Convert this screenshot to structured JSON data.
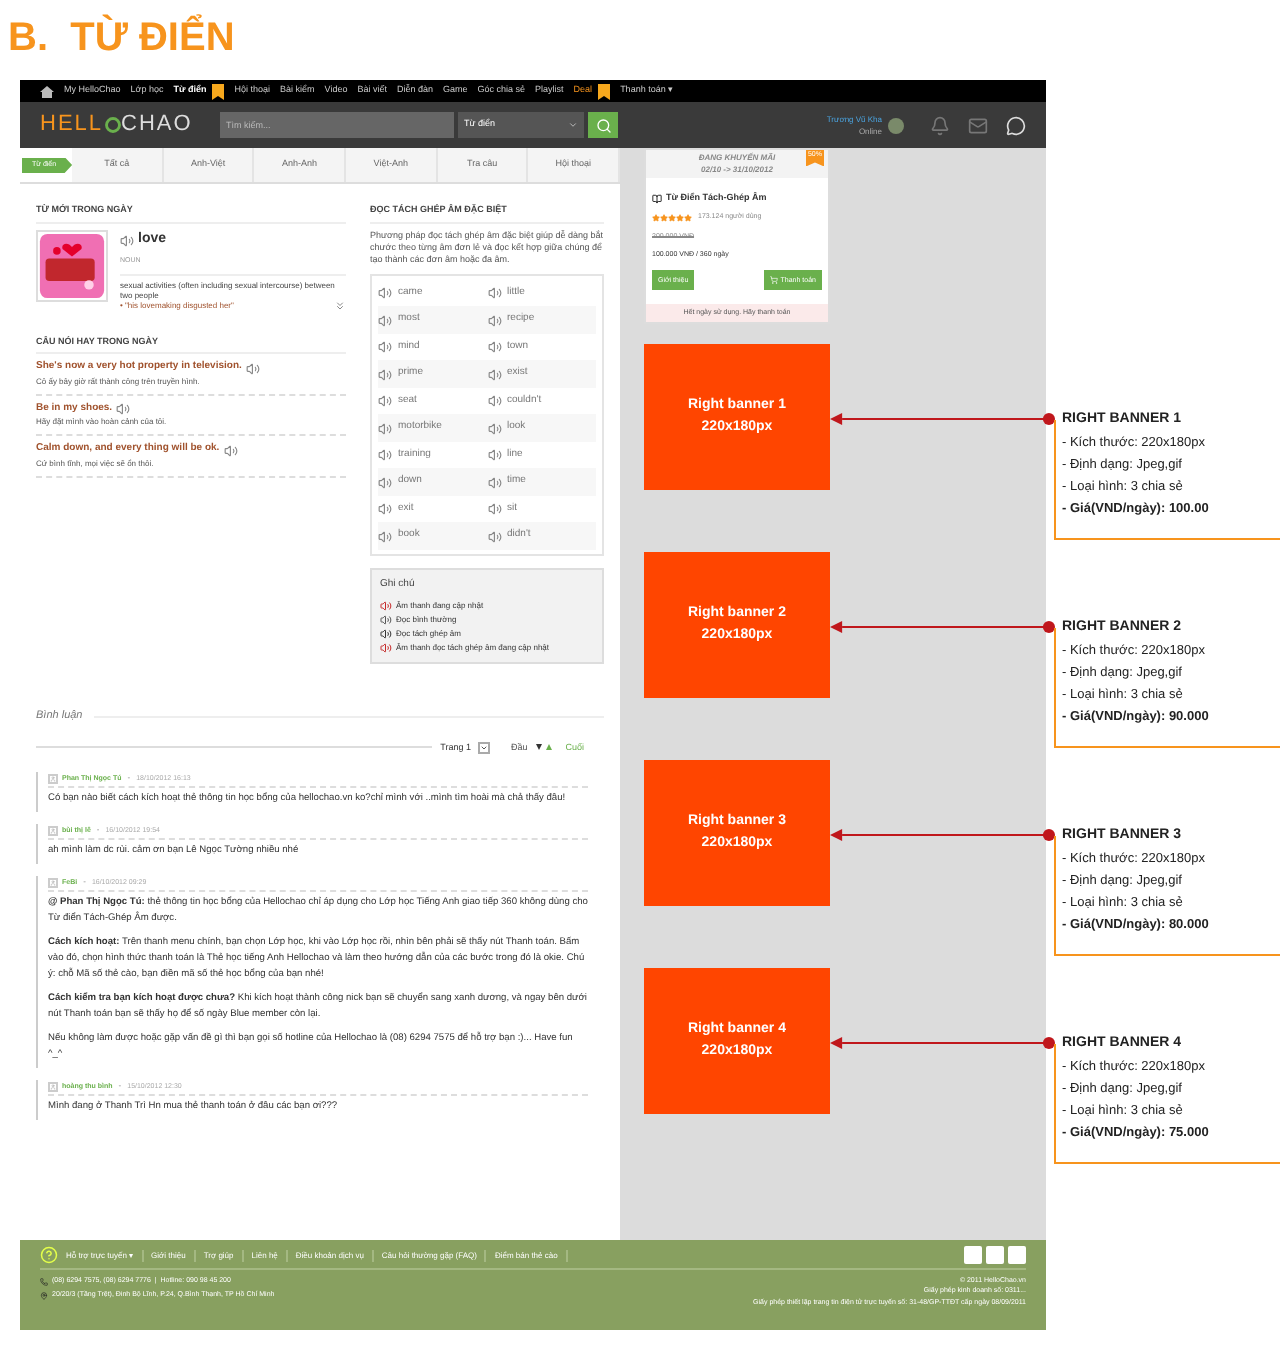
{
  "heading": "B.  TỪ ĐIỂN",
  "nav": [
    {
      "label": "My HelloChao",
      "selected": false,
      "kind": "link",
      "badge": false
    },
    {
      "label": "Lớp học",
      "selected": false,
      "kind": "link",
      "badge": false
    },
    {
      "label": "Từ điển",
      "selected": true,
      "kind": "link",
      "badge": true
    },
    {
      "label": "Hội thoại",
      "selected": false,
      "kind": "link",
      "badge": false
    },
    {
      "label": "Bài kiểm",
      "selected": false,
      "kind": "link",
      "badge": false
    },
    {
      "label": "Video",
      "selected": false,
      "kind": "link",
      "badge": false
    },
    {
      "label": "Bài viết",
      "selected": false,
      "kind": "link",
      "badge": false
    },
    {
      "label": "Diễn đàn",
      "selected": false,
      "kind": "link",
      "badge": false
    },
    {
      "label": "Game",
      "selected": false,
      "kind": "link",
      "badge": false
    },
    {
      "label": "Góc chia sẻ",
      "selected": false,
      "kind": "link",
      "badge": false
    },
    {
      "label": "Playlist",
      "selected": false,
      "kind": "link",
      "badge": false
    },
    {
      "label": "Deal",
      "selected": false,
      "kind": "deal",
      "badge": true
    },
    {
      "label": "Thanh toán ▾",
      "selected": false,
      "kind": "link",
      "badge": false
    }
  ],
  "header": {
    "logo_1": "HELL",
    "logo_2": "CHAO",
    "search_placeholder": "Tìm kiếm...",
    "select": "Từ điển",
    "user": "Trương Vũ Kha",
    "status": "Online"
  },
  "tabs": {
    "tag": "Từ điển",
    "items": [
      {
        "label": "Tất cả",
        "selected": false
      },
      {
        "label": "Anh-Việt",
        "selected": false
      },
      {
        "label": "Anh-Anh",
        "selected": false
      },
      {
        "label": "Việt-Anh",
        "selected": false
      },
      {
        "label": "Tra câu",
        "selected": false
      },
      {
        "label": "Hội thoại",
        "selected": false
      }
    ]
  },
  "word_of_day": {
    "title": "TỪ MỚI TRONG NGÀY",
    "word": "love",
    "pos": "NOUN",
    "definition": "sexual activities (often including sexual intercourse) between two people",
    "example": "• \"his lovemaking disgusted her\""
  },
  "quotes": {
    "title": "CÂU NÓI HAY TRONG NGÀY",
    "items": [
      {
        "text": "She's now a very hot property in television.",
        "translation": "Cô ấy bây giờ rất thành công trên truyền hình."
      },
      {
        "text": "Be in my shoes.",
        "translation": "Hãy đặt mình vào hoàn cảnh của tôi."
      },
      {
        "text": "Calm down, and every thing will be ok.",
        "translation": "Cứ bình tĩnh, mọi việc sẽ ổn thôi."
      }
    ]
  },
  "phonics": {
    "title": "ĐỌC TÁCH GHÉP ÂM ĐẶC BIỆT",
    "description": "Phương pháp đọc tách ghép âm đặc biệt giúp dễ dàng bắt chước theo từng âm đơn lẻ và đọc kết hợp giữa chúng để tạo thành các đơn âm hoặc đa âm.",
    "words": [
      "came",
      "little",
      "most",
      "recipe",
      "mind",
      "town",
      "prime",
      "exist",
      "seat",
      "couldn't",
      "motorbike",
      "look",
      "training",
      "line",
      "down",
      "time",
      "exit",
      "sit",
      "book",
      "didn't"
    ],
    "notes_title": "Ghi chú",
    "notes": [
      {
        "kind": "updating",
        "text": "Âm thanh đang cập nhật"
      },
      {
        "kind": "normal",
        "text": "Đọc bình thường"
      },
      {
        "kind": "split",
        "text": "Đọc tách ghép âm"
      },
      {
        "kind": "split_updating",
        "text": "Âm thanh đọc tách ghép âm đang cập nhật"
      }
    ]
  },
  "comments": {
    "title": "Bình luận",
    "page": "Trang 1",
    "first": "Đầu",
    "last": "Cuối",
    "items": [
      {
        "author": "Phan Thị Ngọc Tú",
        "separator": "-",
        "date": "18/10/2012 16:13",
        "paragraphs": [
          "Có bạn nào biết cách kích hoạt thẻ thông tin học bổng của hellochao.vn ko?chỉ mình với ..mình tìm hoài mà chả thấy đâu!"
        ]
      },
      {
        "author": "bùi thị lê",
        "separator": "-",
        "date": "16/10/2012 19:54",
        "paragraphs": [
          "ah mình làm dc rùi. cảm ơn bạn Lê Ngọc Tường nhiều nhé"
        ]
      },
      {
        "author": "FeBi",
        "separator": "-",
        "date": "16/10/2012 09:29",
        "paragraphs": [
          "**@ Phan Thị Ngọc Tú:** thẻ thông tin học bổng của Hellochao chỉ áp dụng cho Lớp học Tiếng Anh giao tiếp 360 không dùng cho Từ điển Tách-Ghép Âm được.",
          "**Cách kích hoạt:** Trên thanh menu chính, bạn chọn Lớp học, khi vào Lớp học rồi, nhìn bên phải sẽ thấy nút Thanh toán. Bấm vào đó, chọn hình thức thanh toán là Thẻ học tiếng Anh Hellochao và làm theo hướng dẫn của các bước trong đó là okie. Chú ý: chỗ Mã số thẻ cào, bạn điền mã số thẻ học bổng của bạn nhé!",
          "**Cách kiểm tra bạn kích hoạt được chưa?** Khi kích hoạt thành công nick bạn sẽ chuyển sang xanh dương, và ngay bên dưới nút Thanh toán bạn sẽ thấy họ để số ngày Blue member còn lại.",
          "Nếu không làm được hoặc gặp vấn đề gì thì bạn gọi số hotline của Hellochao là (08) 6294 7575 để hỗ trợ bạn :)... Have fun ^_^"
        ]
      },
      {
        "author": "hoàng thu bình",
        "separator": "-",
        "date": "15/10/2012 12:30",
        "paragraphs": [
          "Mình đang ở Thanh Trì Hn mua thẻ thanh toán ở đâu các bạn ơi???"
        ]
      }
    ]
  },
  "promo": {
    "title": "ĐANG KHUYẾN MÃI",
    "period": "02/10 -> 31/10/2012",
    "discount": "50%",
    "product": "Từ Điển Tách-Ghép Âm",
    "stars": 5,
    "users": "173.124 người dùng",
    "old_price": "200.000 VNĐ",
    "price": "100.000 VNĐ / 360 ngày",
    "buttons": [
      "Giới thiệu",
      "Thanh toán"
    ],
    "notice": "Hết ngày sử dụng. Hãy thanh toán"
  },
  "banners": [
    {
      "label": "Right banner 1",
      "size": "220x180px",
      "note_title": "RIGHT BANNER 1",
      "note_lines": [
        "- Kích thước: 220x180px",
        "- Định dạng: Jpeg,gif",
        "- Loại hình: 3 chia sẻ"
      ],
      "price": "- Giá(VND/ngày): 100.00"
    },
    {
      "label": "Right banner 2",
      "size": "220x180px",
      "note_title": "RIGHT BANNER 2",
      "note_lines": [
        "- Kích thước: 220x180px",
        "- Định dạng: Jpeg,gif",
        "- Loại hình: 3 chia sẻ"
      ],
      "price": "- Giá(VND/ngày): 90.000"
    },
    {
      "label": "Right banner 3",
      "size": "220x180px",
      "note_title": "RIGHT BANNER 3",
      "note_lines": [
        "- Kích thước: 220x180px",
        "- Định dạng: Jpeg,gif",
        "- Loại hình: 3 chia sẻ"
      ],
      "price": "- Giá(VND/ngày): 80.000"
    },
    {
      "label": "Right banner 4",
      "size": "220x180px",
      "note_title": "RIGHT BANNER 4",
      "note_lines": [
        "- Kích thước: 220x180px",
        "- Định dạng: Jpeg,gif",
        "- Loại hình: 3 chia sẻ"
      ],
      "price": "- Giá(VND/ngày): 75.000"
    }
  ],
  "footer": {
    "links": [
      "Hỗ trợ trực tuyến ▾",
      "Giới thiệu",
      "Trợ giúp",
      "Liên hệ",
      "Điều khoản dịch vụ",
      "Câu hỏi thường gặp (FAQ)",
      "Điểm bán thẻ cào"
    ],
    "phone": "(08) 6294 7575, (08) 6294 7776  |  Hotline: 090 98 45 200",
    "address": "20/20/3 (Tầng Trệt), Đinh Bộ Lĩnh, P.24, Q.Bình Thạnh, TP Hồ Chí Minh",
    "copyright": "© 2011 HelloChao.vn",
    "license_1": "Giấy phép kinh doanh số: 0311...",
    "license_2": "Giấy phép thiết lập trang tin điện tử trực tuyến số: 31-48/GP-TTĐT cấp ngày 08/09/2011"
  }
}
